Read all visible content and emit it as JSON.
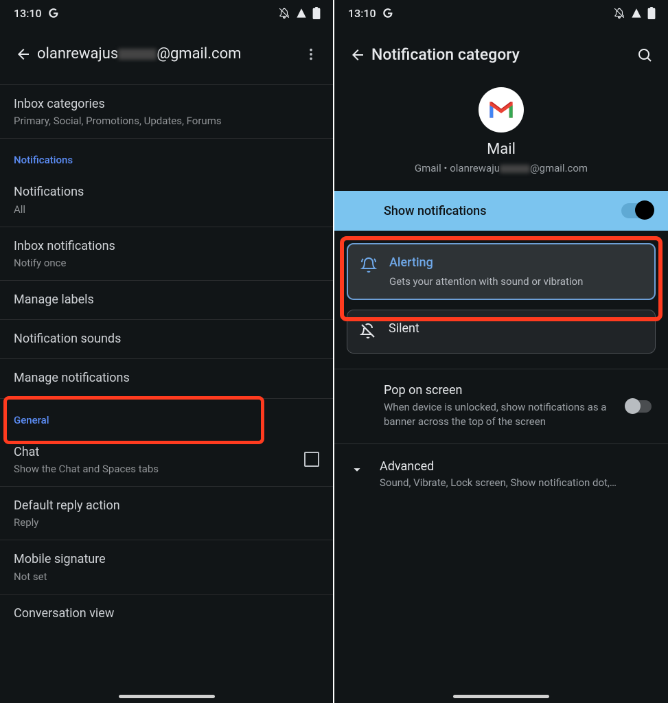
{
  "statusbar": {
    "time": "13:10"
  },
  "left": {
    "title_prefix": "olanrewajus",
    "title_suffix": "@gmail.com",
    "rows": {
      "inbox_cat": {
        "primary": "Inbox categories",
        "secondary": "Primary, Social, Promotions, Updates, Forums"
      },
      "section_notifications": "Notifications",
      "notifications": {
        "primary": "Notifications",
        "secondary": "All"
      },
      "inbox_notif": {
        "primary": "Inbox notifications",
        "secondary": "Notify once"
      },
      "manage_labels": {
        "primary": "Manage labels"
      },
      "notif_sounds": {
        "primary": "Notification sounds"
      },
      "manage_notifications": {
        "primary": "Manage notifications"
      },
      "section_general": "General",
      "chat": {
        "primary": "Chat",
        "secondary": "Show the Chat and Spaces tabs"
      },
      "default_reply": {
        "primary": "Default reply action",
        "secondary": "Reply"
      },
      "mobile_sig": {
        "primary": "Mobile signature",
        "secondary": "Not set"
      },
      "conversation_view": {
        "primary": "Conversation view"
      }
    }
  },
  "right": {
    "title": "Notification category",
    "app_name": "Mail",
    "app_sub_prefix": "Gmail • olanrewaju",
    "app_sub_suffix": "@gmail.com",
    "show_notifications": "Show notifications",
    "alerting": {
      "title": "Alerting",
      "sub": "Gets your attention with sound or vibration"
    },
    "silent": {
      "title": "Silent"
    },
    "pop": {
      "title": "Pop on screen",
      "sub": "When device is unlocked, show notifications as a banner across the top of the screen"
    },
    "advanced": {
      "title": "Advanced",
      "sub": "Sound, Vibrate, Lock screen, Show notification dot,…"
    }
  }
}
